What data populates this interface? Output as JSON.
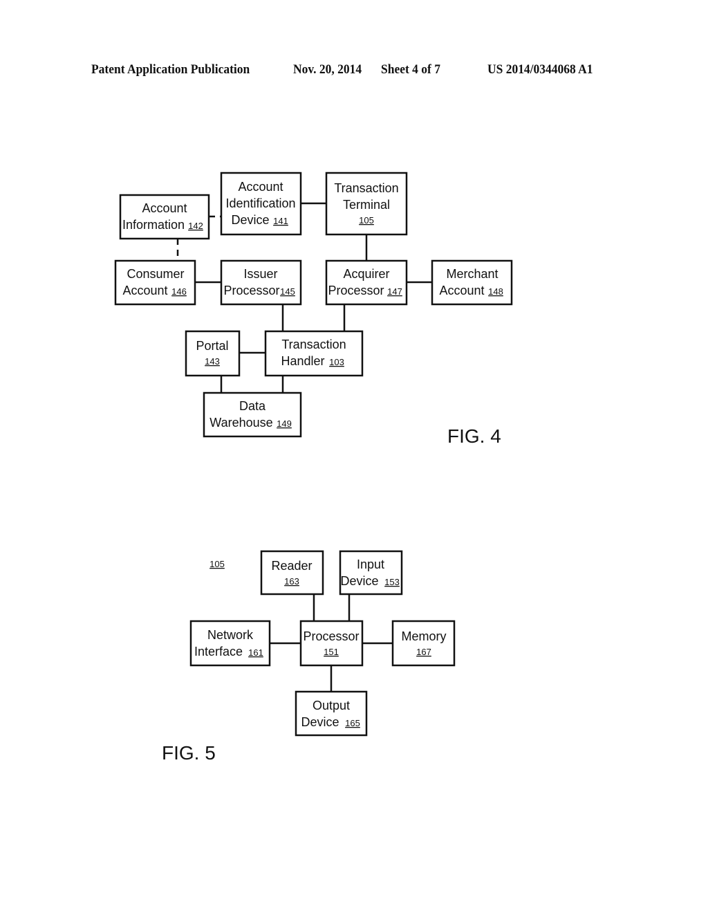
{
  "header": {
    "publication": "Patent Application Publication",
    "date": "Nov. 20, 2014",
    "sheet": "Sheet 4 of 7",
    "number": "US 2014/0344068 A1"
  },
  "fig4": {
    "label": "FIG. 4",
    "boxes": {
      "account_information": {
        "line1": "Account",
        "line2": "Information",
        "ref": "142"
      },
      "account_identification_device": {
        "line1": "Account",
        "line2": "Identification",
        "line3": "Device",
        "ref": "141"
      },
      "transaction_terminal": {
        "line1": "Transaction",
        "line2": "Terminal",
        "ref": "105"
      },
      "consumer_account": {
        "line1": "Consumer",
        "line2": "Account",
        "ref": "146"
      },
      "issuer_processor": {
        "line1": "Issuer",
        "line2": "Processor",
        "ref": "145"
      },
      "acquirer_processor": {
        "line1": "Acquirer",
        "line2": "Processor",
        "ref": "147"
      },
      "merchant_account": {
        "line1": "Merchant",
        "line2": "Account",
        "ref": "148"
      },
      "portal": {
        "line1": "Portal",
        "ref": "143"
      },
      "transaction_handler": {
        "line1": "Transaction",
        "line2": "Handler",
        "ref": "103"
      },
      "data_warehouse": {
        "line1": "Data",
        "line2": "Warehouse",
        "ref": "149"
      }
    }
  },
  "fig5": {
    "label": "FIG. 5",
    "ref": "105",
    "boxes": {
      "reader": {
        "line1": "Reader",
        "ref": "163"
      },
      "input_device": {
        "line1": "Input",
        "line2": "Device",
        "ref": "153"
      },
      "network_interface": {
        "line1": "Network",
        "line2": "Interface",
        "ref": "161"
      },
      "processor": {
        "line1": "Processor",
        "ref": "151"
      },
      "memory": {
        "line1": "Memory",
        "ref": "167"
      },
      "output_device": {
        "line1": "Output",
        "line2": "Device",
        "ref": "165"
      }
    }
  }
}
